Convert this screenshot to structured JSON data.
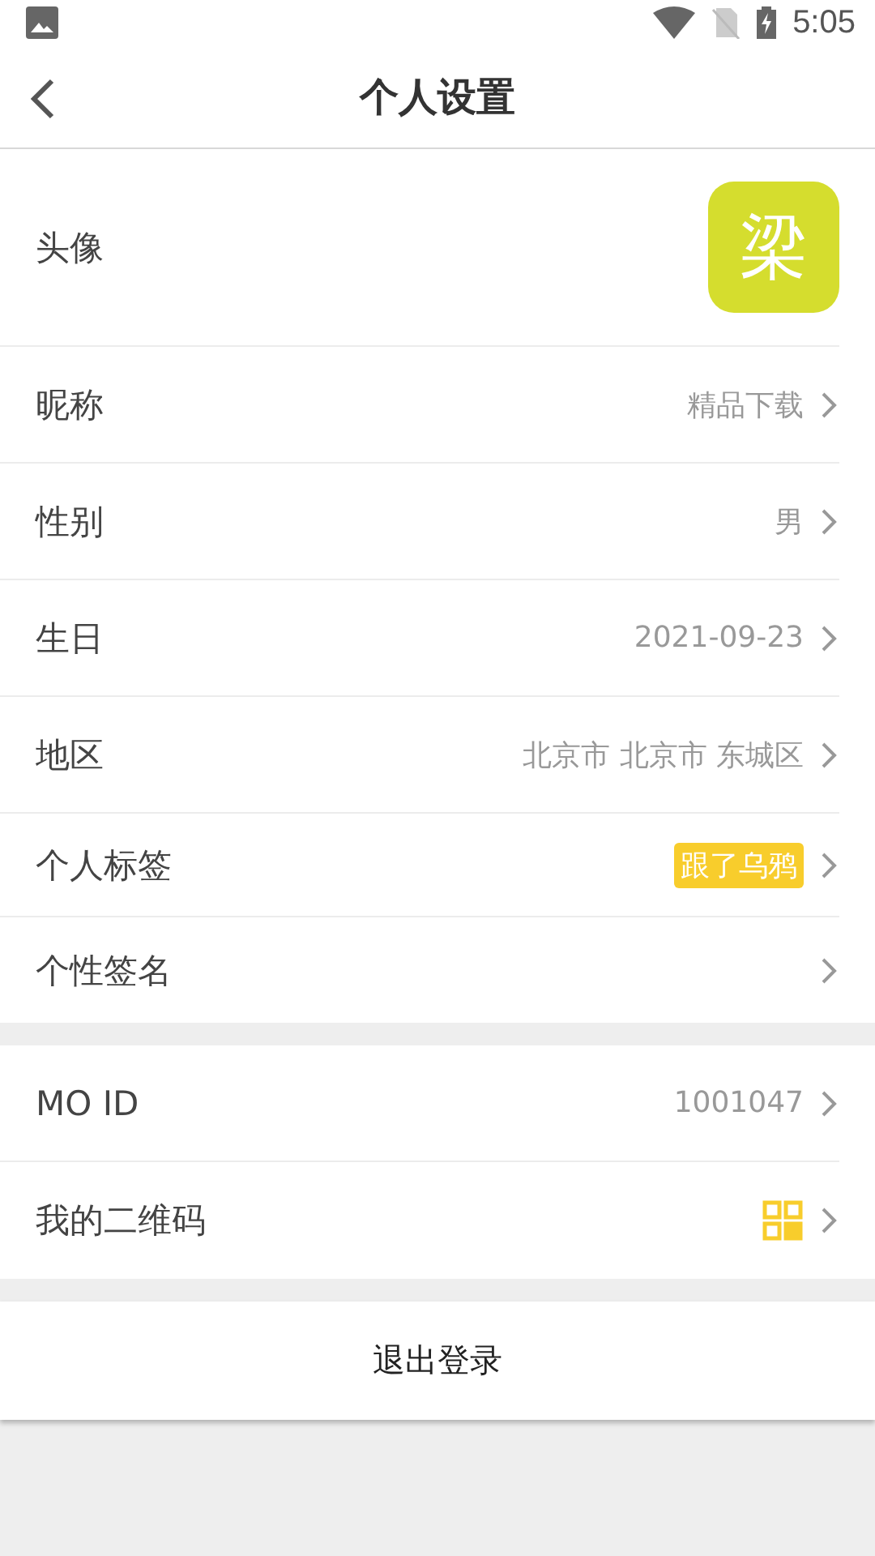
{
  "status_bar": {
    "time": "5:05"
  },
  "header": {
    "title": "个人设置"
  },
  "sections": [
    {
      "rows": [
        {
          "kind": "avatar",
          "label": "头像",
          "value": "梁",
          "color": "#d5dd2e"
        },
        {
          "kind": "text",
          "label": "昵称",
          "value": "精品下载"
        },
        {
          "kind": "text",
          "label": "性别",
          "value": "男"
        },
        {
          "kind": "text",
          "label": "生日",
          "value": "2021-09-23"
        },
        {
          "kind": "text",
          "label": "地区",
          "value": "北京市 北京市 东城区"
        },
        {
          "kind": "tag",
          "label": "个人标签",
          "value": "跟了乌鸦",
          "color": "#f8cd2c"
        },
        {
          "kind": "empty",
          "label": "个性签名"
        }
      ]
    },
    {
      "rows": [
        {
          "kind": "text",
          "label": "MO ID",
          "value": "1001047"
        },
        {
          "kind": "qr",
          "label": "我的二维码"
        }
      ]
    }
  ],
  "logout_button": "退出登录"
}
